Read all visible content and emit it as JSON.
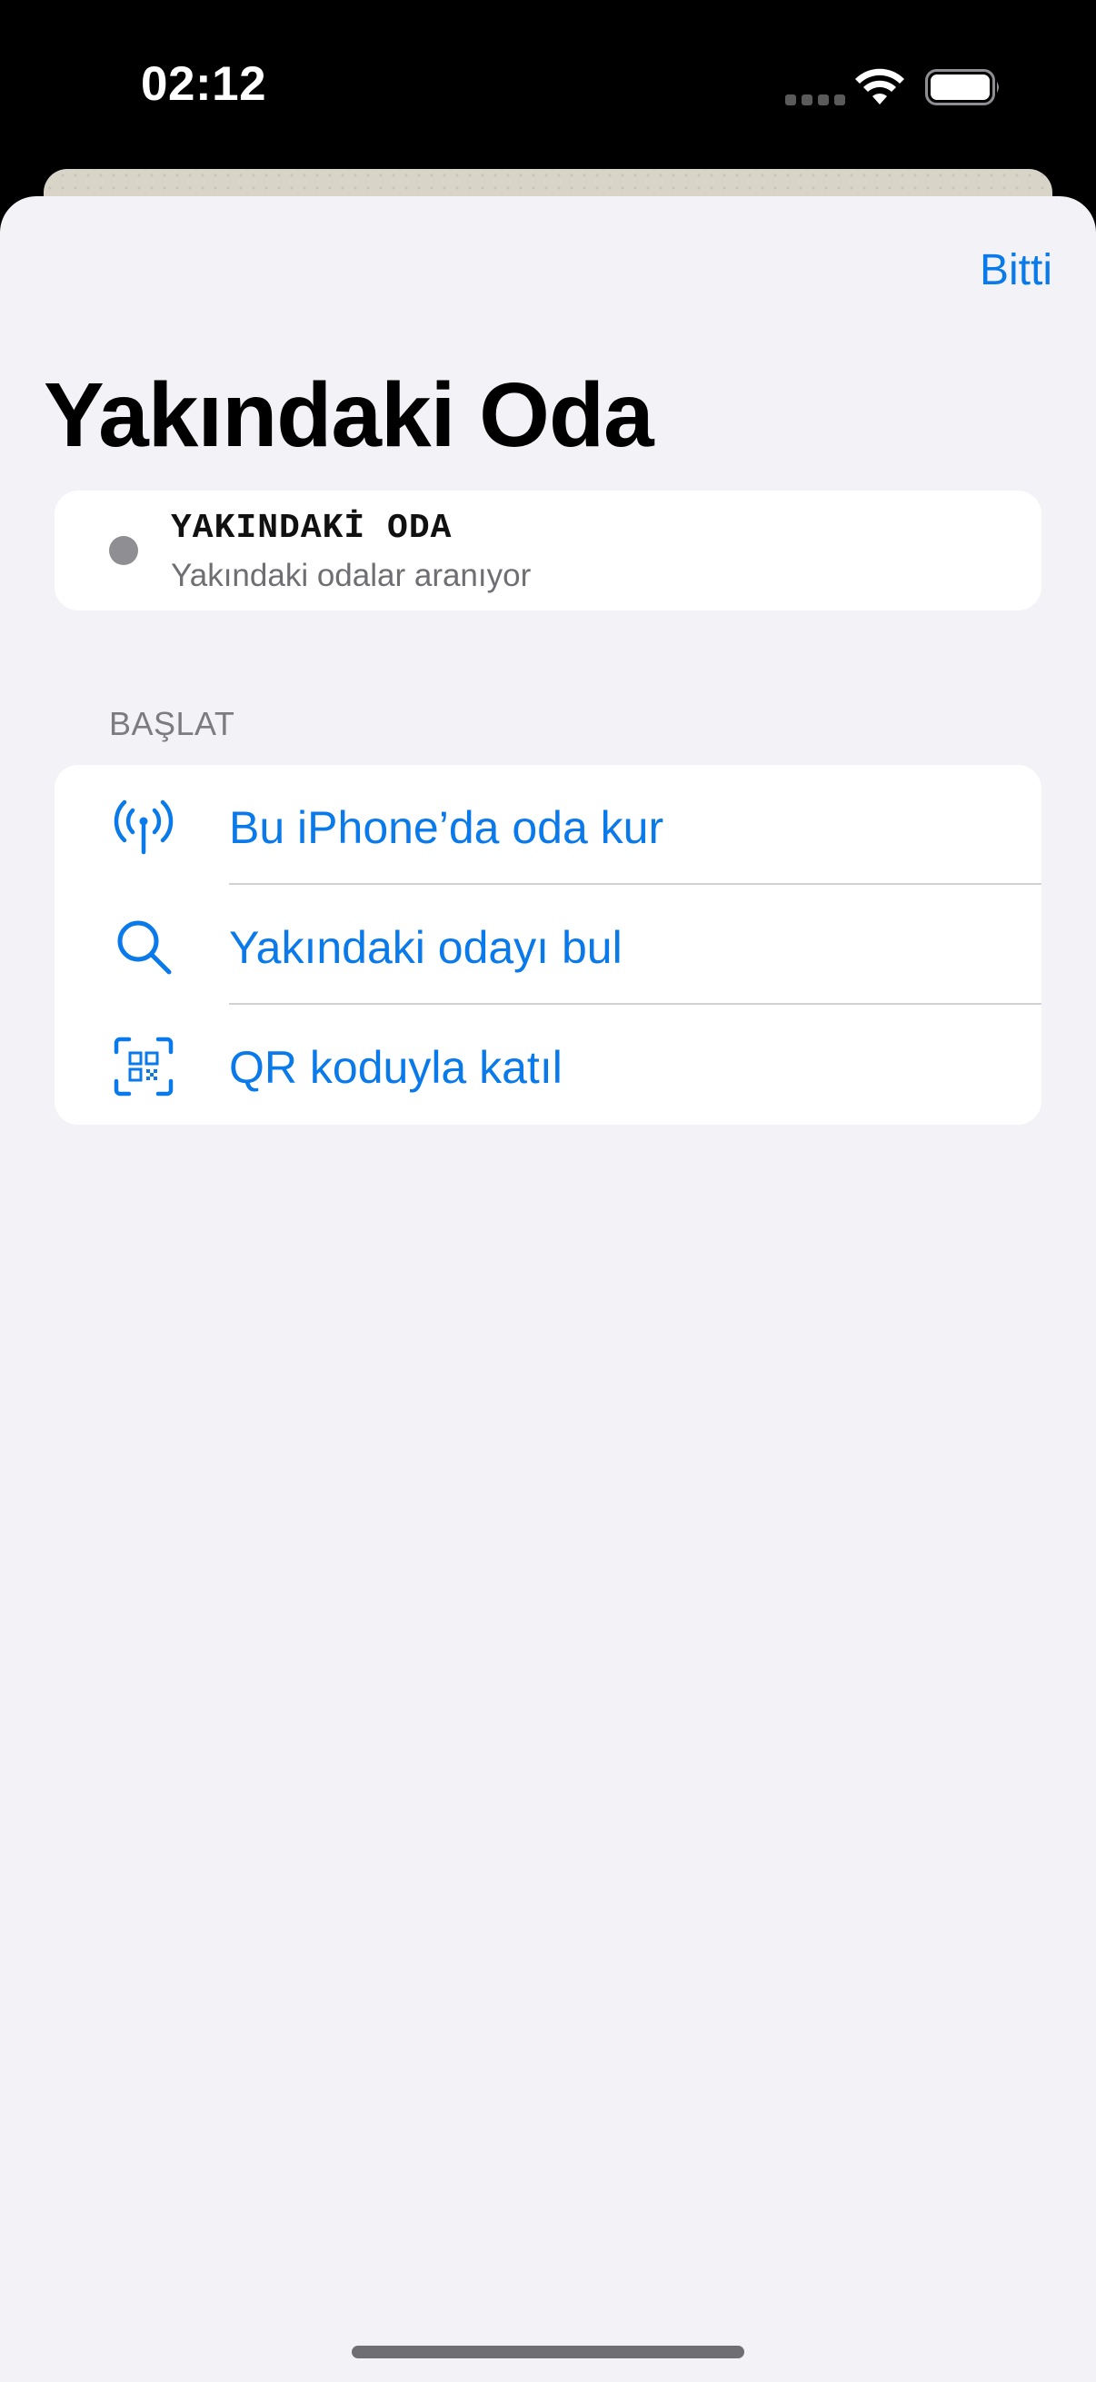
{
  "status_bar": {
    "time": "02:12"
  },
  "sheet": {
    "done_label": "Bitti",
    "title": "Yakındaki Oda"
  },
  "status_card": {
    "label": "YAKINDAKİ ODA",
    "subtitle": "Yakındaki odalar aranıyor"
  },
  "start_section": {
    "header": "BAŞLAT",
    "items": [
      {
        "label": "Bu iPhone’da oda kur",
        "icon": "antenna-broadcast-icon"
      },
      {
        "label": "Yakındaki odayı bul",
        "icon": "magnifying-glass-icon"
      },
      {
        "label": "QR koduyla katıl",
        "icon": "qr-code-viewfinder-icon"
      }
    ]
  },
  "colors": {
    "accent": "#0a7aeb",
    "sheet_background": "#f2f2f7",
    "status_dot": "#8e8e93"
  }
}
